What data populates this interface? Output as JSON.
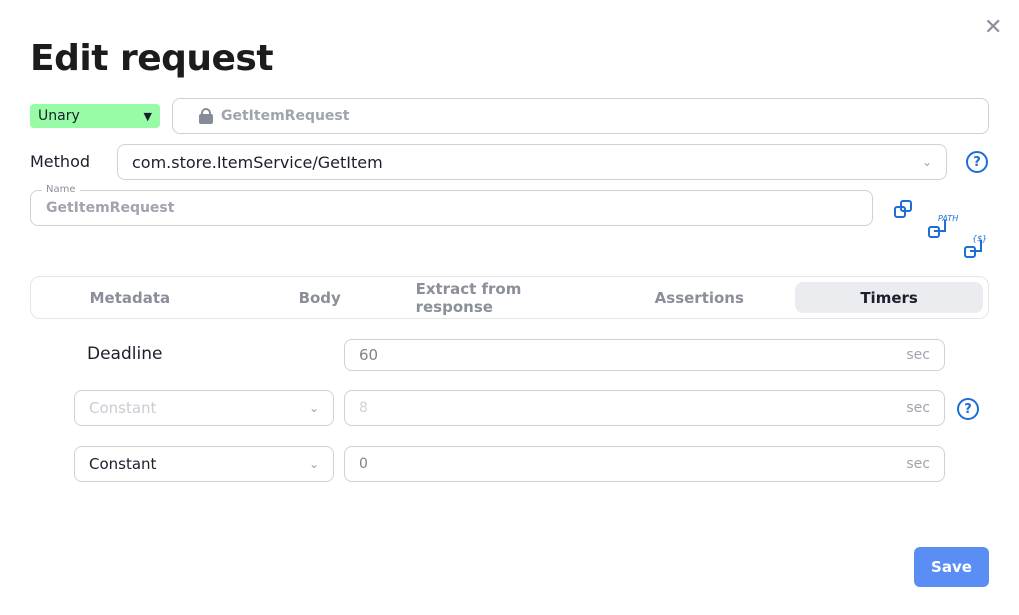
{
  "dialog": {
    "title": "Edit request",
    "close_icon": "close-icon"
  },
  "request_type": {
    "value": "Unary",
    "color": "#97fca5"
  },
  "request_name_locked": "GetItemRequest",
  "method": {
    "label": "Method",
    "value": "com.store.ItemService/GetItem"
  },
  "name_field": {
    "label": "Name",
    "value": "GetItemRequest"
  },
  "copy_buttons": {
    "path_label": "PATH",
    "var_label": "{$}"
  },
  "tabs": [
    {
      "label": "Metadata"
    },
    {
      "label": "Body"
    },
    {
      "label": "Extract from response"
    },
    {
      "label": "Assertions"
    },
    {
      "label": "Timers",
      "active": true
    }
  ],
  "timers": {
    "deadline": {
      "label": "Deadline",
      "value": "60",
      "unit": "sec"
    },
    "rows": [
      {
        "type": "Constant",
        "value": "8",
        "unit": "sec",
        "disabled": true
      },
      {
        "type": "Constant",
        "value": "0",
        "unit": "sec",
        "disabled": false
      }
    ]
  },
  "save_label": "Save",
  "accent": "#1d6ed8"
}
